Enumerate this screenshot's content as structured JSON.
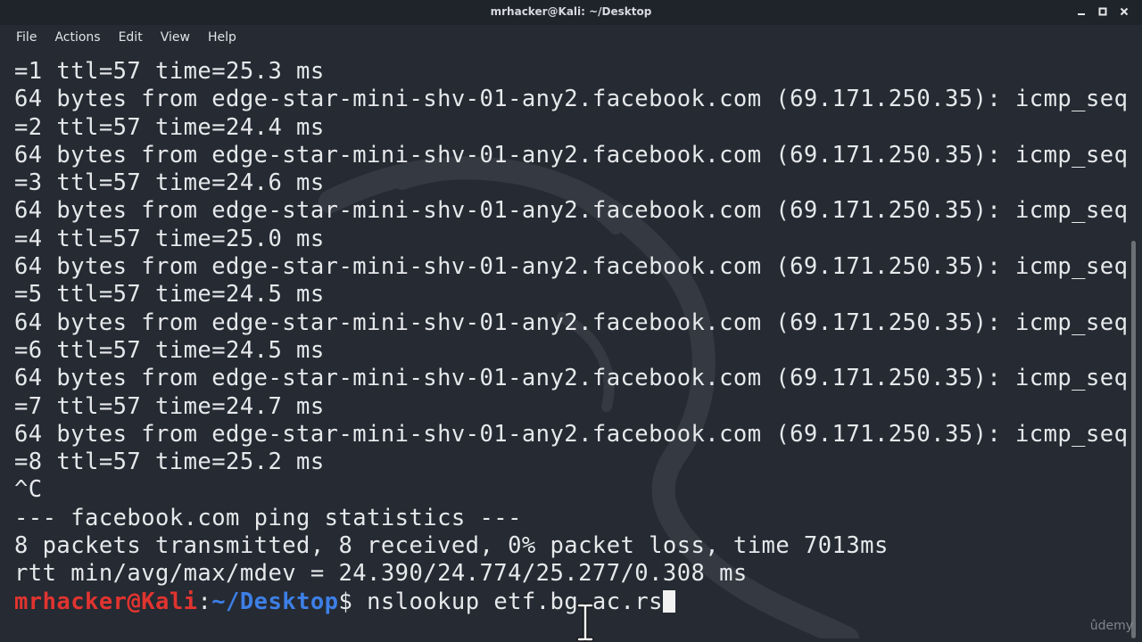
{
  "window": {
    "title": "mrhacker@Kali: ~/Desktop"
  },
  "menu": [
    {
      "label": "File"
    },
    {
      "label": "Actions"
    },
    {
      "label": "Edit"
    },
    {
      "label": "View"
    },
    {
      "label": "Help"
    }
  ],
  "terminal": {
    "lines": [
      "=1 ttl=57 time=25.3 ms",
      "64 bytes from edge-star-mini-shv-01-any2.facebook.com (69.171.250.35): icmp_seq",
      "=2 ttl=57 time=24.4 ms",
      "64 bytes from edge-star-mini-shv-01-any2.facebook.com (69.171.250.35): icmp_seq",
      "=3 ttl=57 time=24.6 ms",
      "64 bytes from edge-star-mini-shv-01-any2.facebook.com (69.171.250.35): icmp_seq",
      "=4 ttl=57 time=25.0 ms",
      "64 bytes from edge-star-mini-shv-01-any2.facebook.com (69.171.250.35): icmp_seq",
      "=5 ttl=57 time=24.5 ms",
      "64 bytes from edge-star-mini-shv-01-any2.facebook.com (69.171.250.35): icmp_seq",
      "=6 ttl=57 time=24.5 ms",
      "64 bytes from edge-star-mini-shv-01-any2.facebook.com (69.171.250.35): icmp_seq",
      "=7 ttl=57 time=24.7 ms",
      "64 bytes from edge-star-mini-shv-01-any2.facebook.com (69.171.250.35): icmp_seq",
      "=8 ttl=57 time=25.2 ms",
      "^C",
      "--- facebook.com ping statistics ---",
      "8 packets transmitted, 8 received, 0% packet loss, time 7013ms",
      "rtt min/avg/max/mdev = 24.390/24.774/25.277/0.308 ms"
    ],
    "prompt": {
      "user_host": "mrhacker@Kali",
      "colon": ":",
      "path": "~/Desktop",
      "dollar": "$",
      "command": " nslookup etf.bg.ac.rs"
    }
  },
  "watermark": {
    "text": "ûdemy"
  },
  "colors": {
    "background": "#252a33",
    "prompt_user": "#e0342f",
    "prompt_path": "#3d7fe6",
    "text": "#e6e8ea"
  },
  "icons": {
    "minimize": "minimize-icon",
    "maximize": "maximize-icon",
    "close": "close-icon",
    "pointer": "text-cursor-icon"
  }
}
